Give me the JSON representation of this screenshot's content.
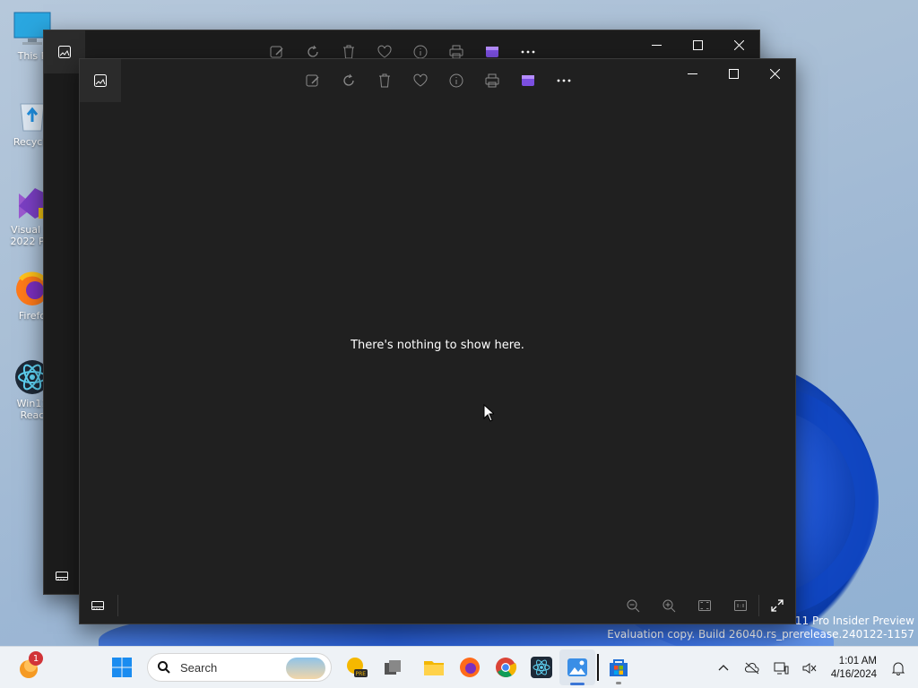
{
  "desktop": {
    "icons": [
      {
        "label": "This P",
        "icon": "monitor-icon"
      },
      {
        "label": "Recycle",
        "icon": "recycle-bin-icon"
      },
      {
        "label": "Visual St 2022 Pre",
        "icon": "visual-studio-icon"
      },
      {
        "label": "Firefo",
        "icon": "firefox-icon"
      },
      {
        "label": "Win11 Reac",
        "icon": "react-icon"
      }
    ],
    "watermark_line1": "ws 11 Pro Insider Preview",
    "watermark_line2": "Evaluation copy. Build 26040.rs_prerelease.240122-1157"
  },
  "photos_window": {
    "empty_message": "There's nothing to show here.",
    "toolbar": [
      "edit-image-icon",
      "rotate-icon",
      "delete-icon",
      "favorite-icon",
      "info-icon",
      "print-icon",
      "clipchamp-icon",
      "more-icon"
    ],
    "bottom_toolbar": [
      "filmstrip-icon",
      "zoom-out-icon",
      "zoom-in-icon",
      "fit-window-icon",
      "actual-size-icon",
      "fullscreen-icon"
    ]
  },
  "taskbar": {
    "notification_badge": "1",
    "search_placeholder": "Search",
    "pinned": [
      "widgets",
      "start",
      "search",
      "copilot-preview",
      "task-view",
      "file-explorer",
      "firefox",
      "chrome",
      "react-app",
      "photos",
      "microsoft-store"
    ],
    "time": "1:01 AM",
    "date": "4/16/2024"
  },
  "colors": {
    "accent": "#3b76d6",
    "window_bg": "#202020",
    "taskbar_bg": "#eef2f6"
  }
}
